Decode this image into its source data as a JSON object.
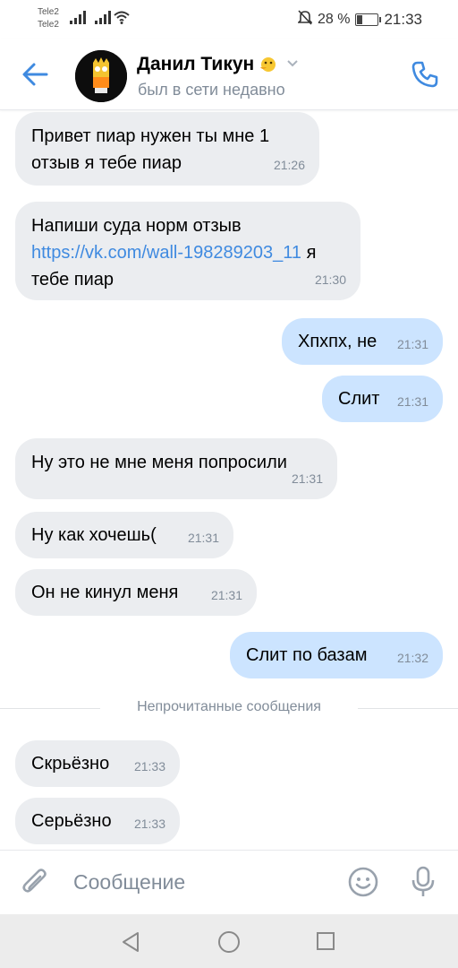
{
  "status_bar": {
    "carrier1": "Tele2",
    "carrier2": "Tele2",
    "battery": "28 %",
    "battery_level": 0.28,
    "time": "21:33"
  },
  "header": {
    "name": "Данил Тикун",
    "status": "был в сети недавно"
  },
  "messages": [
    {
      "dir": "in",
      "text": "Привет пиар нужен ты мне 1 отзыв я тебе пиар",
      "time": "21:26"
    },
    {
      "dir": "in",
      "text_before": "Напиши суда норм отзыв ",
      "link": "https://vk.com/wall-198289203_11",
      "text_after": " я тебе пиар",
      "time": "21:30"
    },
    {
      "dir": "out",
      "text": "Хпхпх, не",
      "time": "21:31"
    },
    {
      "dir": "out",
      "text": "Слит",
      "time": "21:31"
    },
    {
      "dir": "in",
      "text": "Ну это не мне меня попросили",
      "time": "21:31"
    },
    {
      "dir": "in",
      "text": "Ну как хочешь(",
      "time": "21:31"
    },
    {
      "dir": "in",
      "text": "Он не кинул меня",
      "time": "21:31"
    },
    {
      "dir": "out",
      "text": "Слит по базам",
      "time": "21:32"
    },
    {
      "dir": "in",
      "text": "Скрьёзно",
      "time": "21:33"
    },
    {
      "dir": "in",
      "text": "Серьёзно",
      "time": "21:33"
    }
  ],
  "divider": "Непрочитанные сообщения",
  "composer": {
    "placeholder": "Сообщение"
  },
  "colors": {
    "accent": "#3f8ae0",
    "incoming": "#ebedf0",
    "outgoing": "#cce4ff",
    "secondary": "#818c99"
  },
  "icons": [
    "back-arrow-icon",
    "phone-icon",
    "paperclip-icon",
    "smile-icon",
    "microphone-icon",
    "nav-back-icon",
    "nav-home-icon",
    "nav-recents-icon"
  ]
}
